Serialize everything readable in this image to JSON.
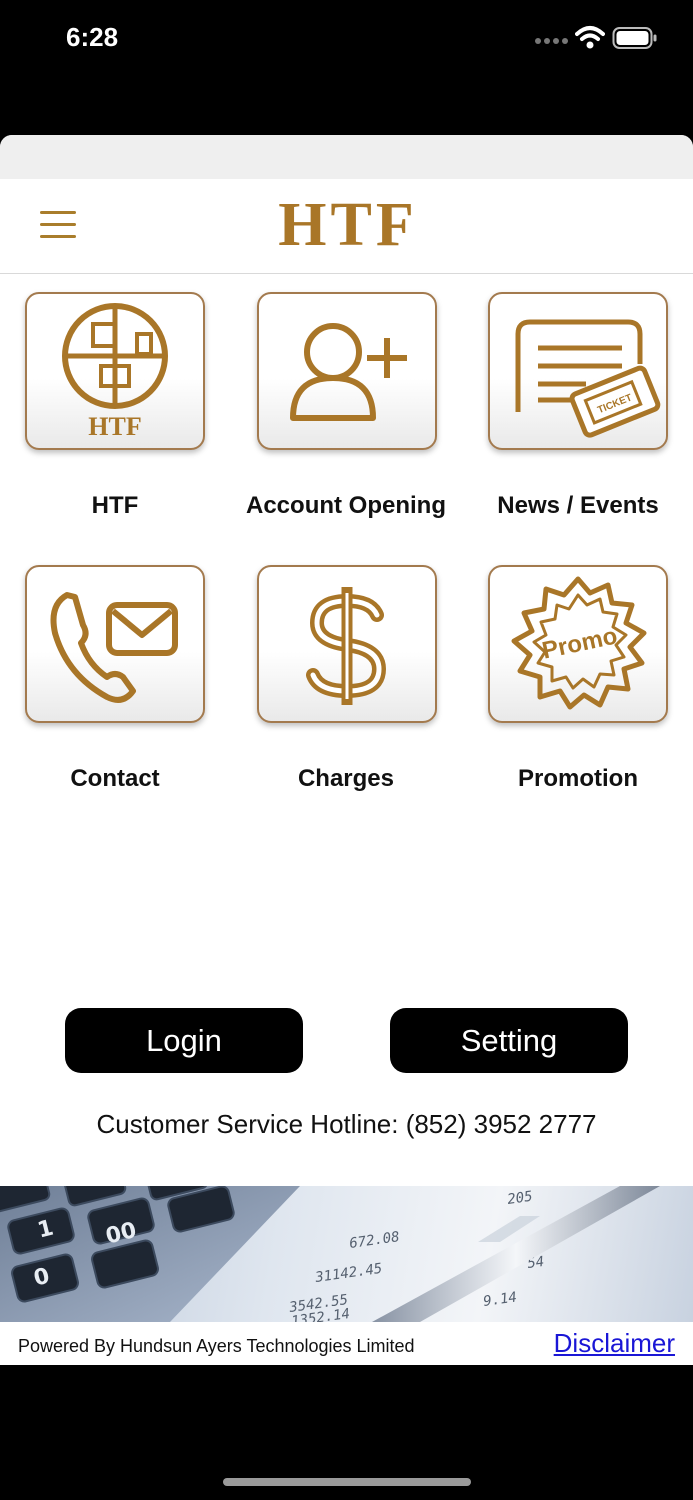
{
  "status_bar": {
    "time": "6:28"
  },
  "header": {
    "menu_icon": "hamburger-menu-icon",
    "logo_text": "HTF"
  },
  "tiles": [
    {
      "label": "HTF",
      "icon": "htf-building-logo-icon",
      "icon_text": "HTF"
    },
    {
      "label": "Account Opening",
      "icon": "add-user-icon"
    },
    {
      "label": "News / Events",
      "icon": "news-ticket-icon",
      "icon_text": "TICKET"
    },
    {
      "label": "Contact",
      "icon": "phone-mail-icon"
    },
    {
      "label": "Charges",
      "icon": "dollar-icon"
    },
    {
      "label": "Promotion",
      "icon": "promo-badge-icon",
      "icon_text": "Promo"
    }
  ],
  "buttons": {
    "login": "Login",
    "setting": "Setting"
  },
  "hotline": "Customer Service Hotline: (852) 3952 2777",
  "banner": {
    "image": "calculator-and-pen-photo",
    "visible_numbers": [
      "1",
      "00",
      "0",
      "31142.45",
      "3542.55",
      "1352.14",
      "672.08",
      "205",
      "54",
      "9.14"
    ]
  },
  "footer": {
    "powered_by": "Powered By Hundsun Ayers Technologies Limited",
    "disclaimer": "Disclaimer"
  },
  "colors": {
    "brand_gold": "#a97628",
    "tile_border": "#a37a4e",
    "button_bg": "#000000",
    "link": "#1a16d6"
  }
}
